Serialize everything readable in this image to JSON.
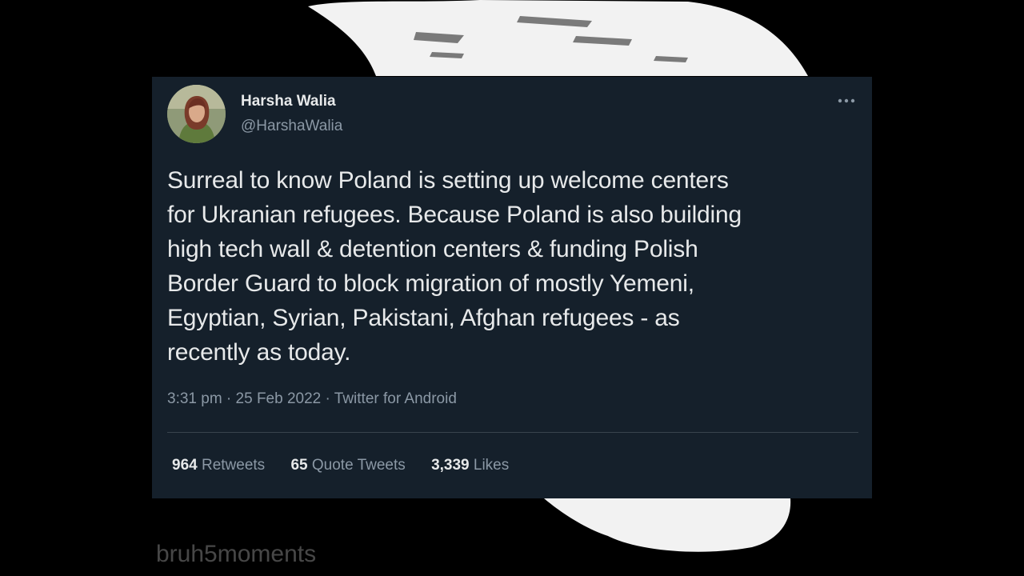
{
  "tweet": {
    "display_name": "Harsha Walia",
    "handle": "@HarshaWalia",
    "text_lines": [
      "Surreal to know Poland is setting up welcome centers",
      "for Ukranian refugees. Because Poland is also building",
      "high tech wall & detention centers & funding Polish",
      "Border Guard to block migration of mostly Yemeni,",
      "Egyptian, Syrian, Pakistani, Afghan refugees - as",
      "recently as today."
    ],
    "timestamp": "3:31 pm · 25 Feb 2022 · Twitter for Android",
    "stats": {
      "retweets_count": "964",
      "retweets_label": "Retweets",
      "quotes_count": "65",
      "quotes_label": "Quote Tweets",
      "likes_count": "3,339",
      "likes_label": "Likes"
    }
  },
  "watermark": "bruh5moments",
  "colors": {
    "card_background": "#15202b",
    "primary_text": "#e7e9ea",
    "secondary_text": "#8b98a5",
    "divider": "#38444d"
  },
  "icons": {
    "more": "more-horizontal-icon",
    "avatar": "profile-avatar"
  }
}
